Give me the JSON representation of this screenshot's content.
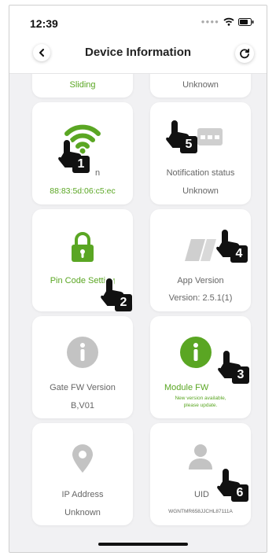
{
  "status": {
    "time": "12:39"
  },
  "header": {
    "title": "Device Information"
  },
  "cards": {
    "partial_left": {
      "value": "Sliding"
    },
    "partial_right": {
      "value": "Unknown"
    },
    "wifi": {
      "label": "n",
      "value": "88:83:5d:06:c5:ec"
    },
    "notification": {
      "label": "Notification status",
      "value": "Unknown"
    },
    "pin": {
      "label": "Pin Code Setting"
    },
    "app_version": {
      "label": "App Version",
      "value": "Version: 2.5.1(1)"
    },
    "gate_fw": {
      "label": "Gate FW Version",
      "value": "B,V01"
    },
    "module_fw": {
      "label": "Module FW",
      "notice_line1": "New version available,",
      "notice_line2": "please update."
    },
    "ip": {
      "label": "IP Address",
      "value": "Unknown"
    },
    "uid": {
      "label": "UID",
      "value": "WGNTMR658JJCHL87111A"
    }
  },
  "callouts": [
    "1",
    "2",
    "3",
    "4",
    "5",
    "6"
  ],
  "colors": {
    "accent": "#5aa623",
    "grey_icon": "#c3c3c3",
    "background": "#f1f1f3"
  }
}
